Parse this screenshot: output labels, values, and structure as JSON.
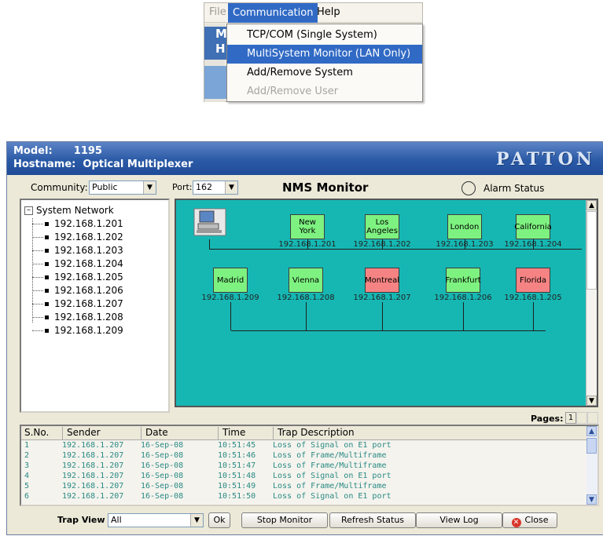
{
  "menu": {
    "menubar": [
      "File",
      "Communication",
      "Help"
    ],
    "side_letters": [
      "M",
      "H"
    ],
    "items": [
      {
        "label": "TCP/COM (Single System)",
        "state": "normal"
      },
      {
        "label": "MultiSystem Monitor (LAN Only)",
        "state": "selected"
      },
      {
        "label": "Add/Remove System",
        "state": "normal"
      },
      {
        "label": "Add/Remove User",
        "state": "disabled"
      }
    ]
  },
  "window": {
    "model_line": "Model:      1195",
    "hostname_line": "Hostname:  Optical Multiplexer",
    "logo": "PATTON"
  },
  "toolbar": {
    "community_label": "Community:",
    "community_value": "Public",
    "port_label": "Port:",
    "port_value": "162",
    "title": "NMS Monitor",
    "alarm_label": "Alarm Status"
  },
  "tree": {
    "root": "System Network",
    "items": [
      "192.168.1.201",
      "192.168.1.202",
      "192.168.1.203",
      "192.168.1.204",
      "192.168.1.205",
      "192.168.1.206",
      "192.168.1.207",
      "192.168.1.208",
      "192.168.1.209"
    ]
  },
  "network": {
    "row1": [
      {
        "name": "New York",
        "ip": "192.168.1.201",
        "status": "ok"
      },
      {
        "name": "Los Angeles",
        "ip": "192.168.1.202",
        "status": "ok"
      },
      {
        "name": "London",
        "ip": "192.168.1.203",
        "status": "ok"
      },
      {
        "name": "California",
        "ip": "192.168.1.204",
        "status": "ok"
      }
    ],
    "row2": [
      {
        "name": "Madrid",
        "ip": "192.168.1.209",
        "status": "ok"
      },
      {
        "name": "Vienna",
        "ip": "192.168.1.208",
        "status": "ok"
      },
      {
        "name": "Montreal",
        "ip": "192.168.1.207",
        "status": "alarm"
      },
      {
        "name": "Frankfurt",
        "ip": "192.168.1.206",
        "status": "ok"
      },
      {
        "name": "Florida",
        "ip": "192.168.1.205",
        "status": "alarm"
      }
    ],
    "colors": {
      "ok": "#7ef280",
      "alarm": "#f58383",
      "background": "#16b7b3"
    }
  },
  "pages": {
    "label": "Pages:",
    "current": "1"
  },
  "trap_table": {
    "headers": [
      "S.No.",
      "Sender",
      "Date",
      "Time",
      "Trap Description"
    ],
    "rows": [
      [
        "1",
        "192.168.1.207",
        "16-Sep-08",
        "10:51:45",
        "Loss of Signal on E1 port"
      ],
      [
        "2",
        "192.168.1.207",
        "16-Sep-08",
        "10:51:46",
        "Loss of Frame/Multiframe"
      ],
      [
        "3",
        "192.168.1.207",
        "16-Sep-08",
        "10:51:47",
        "Loss of Frame/Multiframe"
      ],
      [
        "4",
        "192.168.1.207",
        "16-Sep-08",
        "10:51:48",
        "Loss of Signal on E1 port"
      ],
      [
        "5",
        "192.168.1.207",
        "16-Sep-08",
        "10:51:49",
        "Loss of Frame/Multiframe"
      ],
      [
        "6",
        "192.168.1.207",
        "16-Sep-08",
        "10:51:50",
        "Loss of Signal on E1 port"
      ]
    ]
  },
  "footer": {
    "trap_view_label": "Trap View",
    "trap_view_value": "All",
    "ok": "Ok",
    "stop_monitor": "Stop Monitor",
    "refresh_status": "Refresh Status",
    "view_log": "View Log",
    "close": "Close"
  }
}
